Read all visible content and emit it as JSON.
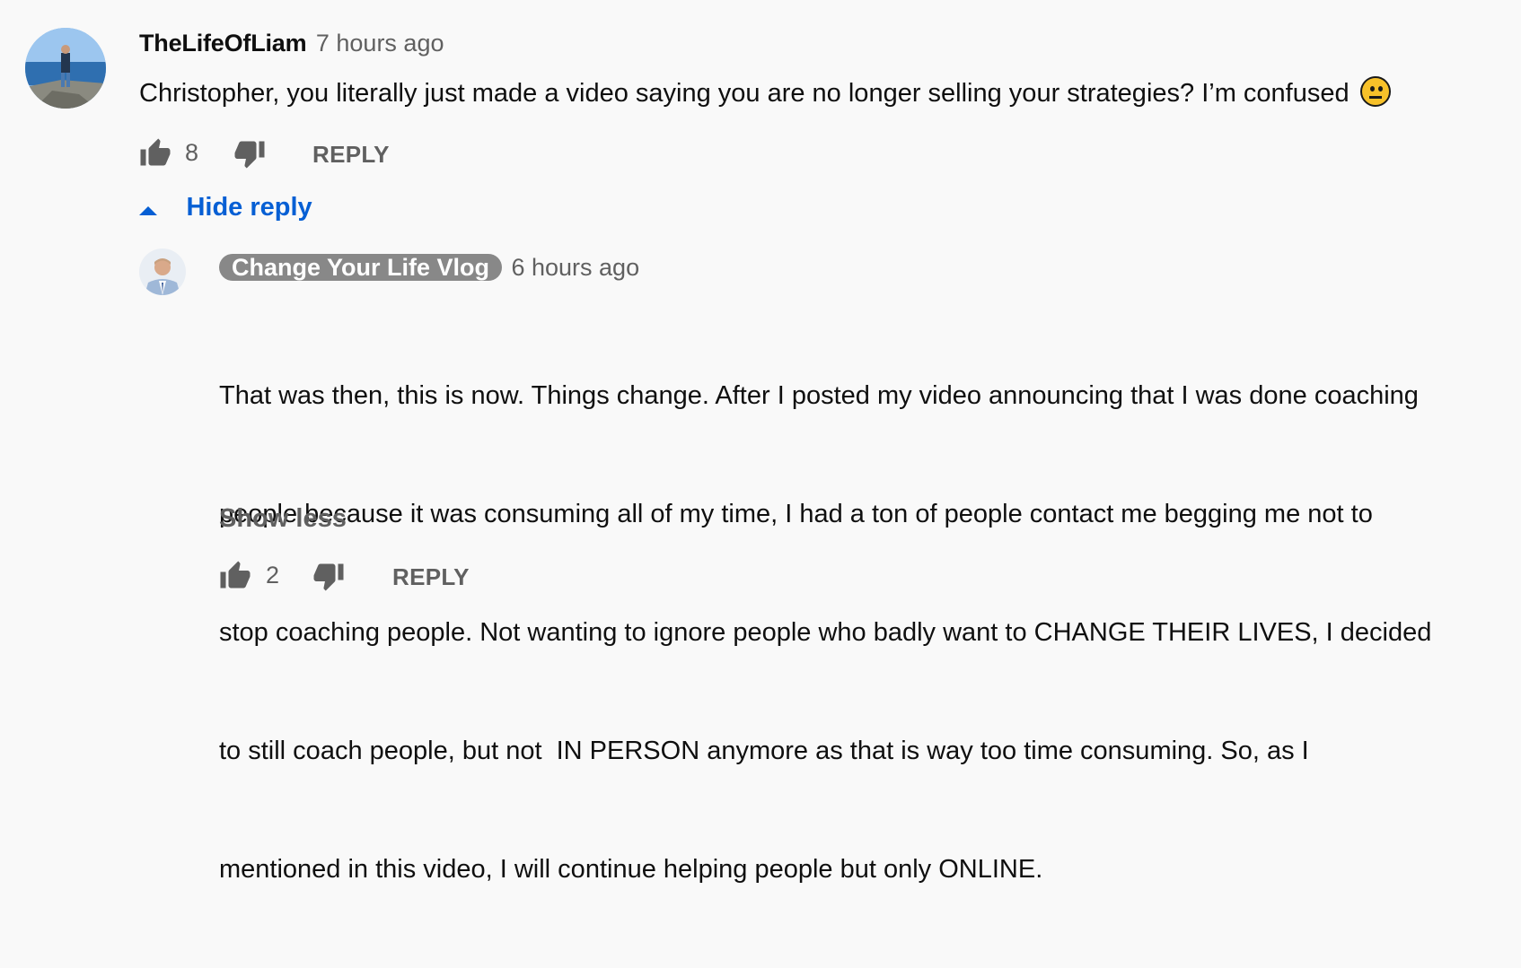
{
  "comment": {
    "author": "TheLifeOfLiam",
    "time": "7 hours ago",
    "text": "Christopher, you literally just made a video saying you are no longer selling your strategies? I’m confused",
    "emoji_icon": "neutral-face-emoji",
    "like_count": "8",
    "reply_label": "REPLY"
  },
  "replies_toggle": {
    "label": "Hide reply"
  },
  "reply": {
    "author": "Change Your Life Vlog",
    "time": "6 hours ago",
    "text_lines": [
      "That was then, this is now. Things change. After I posted my video announcing that I was done coaching",
      "people because it was consuming all of my time, I had a ton of people contact me begging me not to",
      "stop coaching people. Not wanting to ignore people who badly want to CHANGE THEIR LIVES, I decided",
      "to still coach people, but not  IN PERSON anymore as that is way too time consuming. So, as I",
      "mentioned in this video, I will continue helping people but only ONLINE."
    ],
    "show_less_label": "Show less",
    "like_count": "2",
    "reply_label": "REPLY"
  },
  "colors": {
    "background": "#f9f9f9",
    "link_blue": "#065fd4",
    "secondary_text": "#606060",
    "owner_badge": "#888888"
  }
}
